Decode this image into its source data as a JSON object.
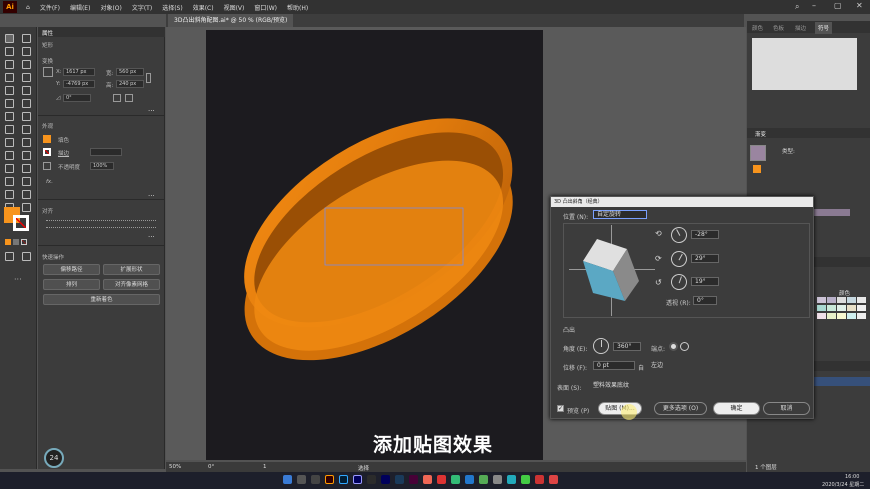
{
  "menu": {
    "items": [
      "文件(F)",
      "编辑(E)",
      "对象(O)",
      "文字(T)",
      "选择(S)",
      "效果(C)",
      "视图(V)",
      "窗口(W)",
      "帮助(H)"
    ]
  },
  "document": {
    "tab_title": "3D凸出斜角配图.ai* @ 50 % (RGB/预览)"
  },
  "properties": {
    "panel_title": "属性",
    "selection": "矩形",
    "transform": "变换",
    "x_label": "X:",
    "x_value": "1617 px",
    "y_label": "Y:",
    "y_value": "-4769 px",
    "w_label": "宽:",
    "w_value": "560 px",
    "h_label": "高:",
    "h_value": "240 px",
    "angle_value": "0°",
    "appearance": "外观",
    "fill": "填色",
    "stroke": "描边",
    "opacity_label": "不透明度",
    "opacity_value": "100%",
    "fx": "fx.",
    "align": "对齐",
    "quick_actions": "快速操作",
    "btn_offset": "偏移路径",
    "btn_expand": "扩展形状",
    "btn_arrange": "排列",
    "btn_pixel": "对齐像素网格",
    "btn_recolor": "重新着色"
  },
  "dialog": {
    "title": "3D 凸出斜角（经典）",
    "position_label": "位置 (N):",
    "position_value": "自定旋转",
    "rot_x": "-28°",
    "rot_y": "29°",
    "rot_z": "19°",
    "perspective_label": "透视 (R):",
    "perspective_value": "0°",
    "section": "凸出",
    "angle_label": "角度 (E):",
    "angle_value": "360°",
    "cap_label": "端点:",
    "offset_label": "位移 (F):",
    "offset_value": "0 pt",
    "offset_from": "自",
    "offset_from_value": "左边",
    "surface_label": "表面 (S):",
    "surface_value": "塑料效果底纹",
    "preview_label": "预览 (P)",
    "btn_map": "贴图 (M)...",
    "btn_more": "更多选项 (O)",
    "btn_ok": "确定",
    "btn_cancel": "取消"
  },
  "right_panel": {
    "tabs": [
      "颜色",
      "色板",
      "描边",
      "符号"
    ],
    "gradient": "渐变",
    "type_label": "类型:",
    "swatch_label": "颜色",
    "layer_count": "1 个图层",
    "layer_label": "1 个图层"
  },
  "status": {
    "zoom": "50%",
    "rotate": "0°",
    "page": "1",
    "mode": "选择"
  },
  "overlay": {
    "subtitle": "添加贴图效果",
    "timer": "24"
  },
  "taskbar": {
    "time": "16:00",
    "date": "2020/3/24 星期二"
  },
  "colors": {
    "accent": "#f7941d",
    "orange": "#ff9a00",
    "dialog_bg": "#3c3c3c",
    "artboard": "#1c1b1f"
  }
}
